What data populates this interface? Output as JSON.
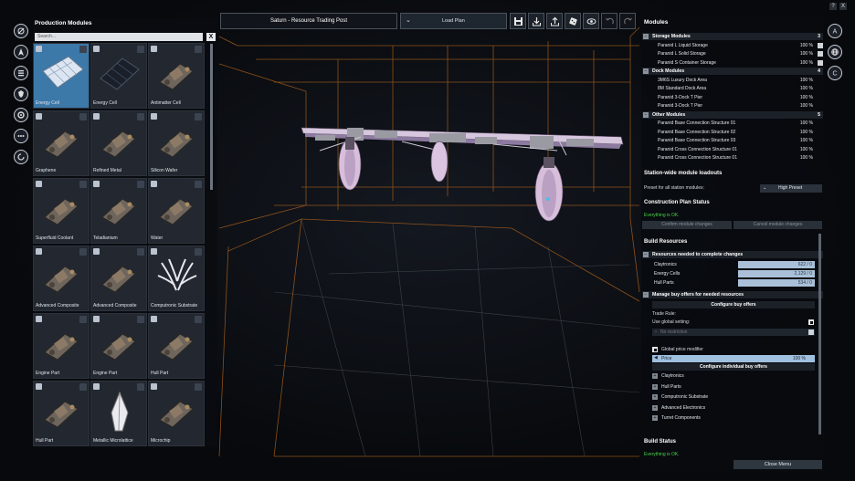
{
  "header": {
    "station_name": "Saturn - Resource Trading Post",
    "load_plan_label": "Load Plan",
    "toolbar_icons": [
      "save-icon",
      "import-icon",
      "export-icon",
      "dice-icon",
      "eye-icon",
      "undo-icon",
      "redo-icon"
    ]
  },
  "top_right": {
    "help_label": "?",
    "close_label": "X"
  },
  "left_icons": [
    "build-icon",
    "navigation-icon",
    "list-icon",
    "shield-icon",
    "settings-icon",
    "more-icon",
    "refresh-icon"
  ],
  "production": {
    "title": "Production Modules",
    "search_placeholder": "Search...",
    "clear_label": "X",
    "tiles": [
      {
        "label": "Energy Cell",
        "art": "solar-panel",
        "selected": true
      },
      {
        "label": "Energy Cell",
        "art": "solar-array",
        "selected": false
      },
      {
        "label": "Antimatter Cell",
        "art": "factory",
        "selected": false
      },
      {
        "label": "Graphene",
        "art": "factory",
        "selected": false
      },
      {
        "label": "Refined Metal",
        "art": "factory",
        "selected": false
      },
      {
        "label": "Silicon Wafer",
        "art": "factory",
        "selected": false
      },
      {
        "label": "Superfluid Coolant",
        "art": "factory",
        "selected": false
      },
      {
        "label": "Teladianium",
        "art": "factory",
        "selected": false
      },
      {
        "label": "Water",
        "art": "factory",
        "selected": false
      },
      {
        "label": "Advanced Composite",
        "art": "factory",
        "selected": false
      },
      {
        "label": "Advanced Composite",
        "art": "factory",
        "selected": false
      },
      {
        "label": "Computronic Substrate",
        "art": "organic",
        "selected": false
      },
      {
        "label": "Engine Part",
        "art": "factory",
        "selected": false
      },
      {
        "label": "Engine Part",
        "art": "factory",
        "selected": false
      },
      {
        "label": "Hull Part",
        "art": "factory",
        "selected": false
      },
      {
        "label": "Hull Part",
        "art": "factory",
        "selected": false
      },
      {
        "label": "Metallic Microlattice",
        "art": "spire",
        "selected": false
      },
      {
        "label": "Microchip",
        "art": "factory",
        "selected": false
      }
    ]
  },
  "modules_panel": {
    "title": "Modules",
    "right_icons": [
      "build-icon",
      "globe-icon",
      "credits-icon"
    ],
    "categories": [
      {
        "name": "Storage Modules",
        "count": "3",
        "items": [
          {
            "name": "Paranid L Liquid Storage",
            "pct": "100 %"
          },
          {
            "name": "Paranid L Solid Storage",
            "pct": "100 %"
          },
          {
            "name": "Paranid S Container Storage",
            "pct": "100 %"
          }
        ]
      },
      {
        "name": "Dock Modules",
        "count": "4",
        "items": [
          {
            "name": "3M6S Luxury Dock Area",
            "pct": "100 %"
          },
          {
            "name": "8M Standard Dock Area",
            "pct": "100 %"
          },
          {
            "name": "Paranid 3-Dock T Pier",
            "pct": "100 %"
          },
          {
            "name": "Paranid 3-Dock T Pier",
            "pct": "100 %"
          }
        ]
      },
      {
        "name": "Other Modules",
        "count": "5",
        "items": [
          {
            "name": "Paranid Base Connection Structure 01",
            "pct": "100 %"
          },
          {
            "name": "Paranid Base Connection Structure 02",
            "pct": "100 %"
          },
          {
            "name": "Paranid Base Connection Structure 03",
            "pct": "100 %"
          },
          {
            "name": "Paranid Cross Connection Structure 01",
            "pct": "100 %"
          },
          {
            "name": "Paranid Cross Connection Structure 01",
            "pct": "100 %"
          }
        ]
      }
    ],
    "loadouts_title": "Station-wide module loadouts",
    "preset_label": "Preset for all station modules:",
    "preset_value": "High Preset",
    "plan_status_title": "Construction Plan Status",
    "plan_status_text": "Everything is OK.",
    "confirm_label": "Confirm module changes",
    "cancel_label": "Cancel module changes",
    "build_resources_title": "Build Resources",
    "resources_needed_label": "Resources needed to complete changes",
    "resources": [
      {
        "name": "Claytronics",
        "value": "622 / 0",
        "fill": 1.0
      },
      {
        "name": "Energy Cells",
        "value": "2,129 / 0",
        "fill": 1.0
      },
      {
        "name": "Hull Parts",
        "value": "534 / 0",
        "fill": 1.0
      }
    ],
    "manage_offers_label": "Manage buy offers for needed resources",
    "configure_offers_label": "Configure buy offers",
    "trade_rule_label": "Trade Rule:",
    "use_global_label": "Use global setting:",
    "no_restriction_label": "No restriction",
    "global_price_label": "Global price modifier",
    "price_label": "Price",
    "price_value": "100 %",
    "configure_individual_label": "Configure individual buy offers",
    "offers": [
      "Claytronics",
      "Hull Parts",
      "Computronic Substrate",
      "Advanced Electronics",
      "Turret Components"
    ],
    "build_status_title": "Build Status",
    "build_status_text": "Everything is OK.",
    "close_menu_label": "Close Menu"
  }
}
